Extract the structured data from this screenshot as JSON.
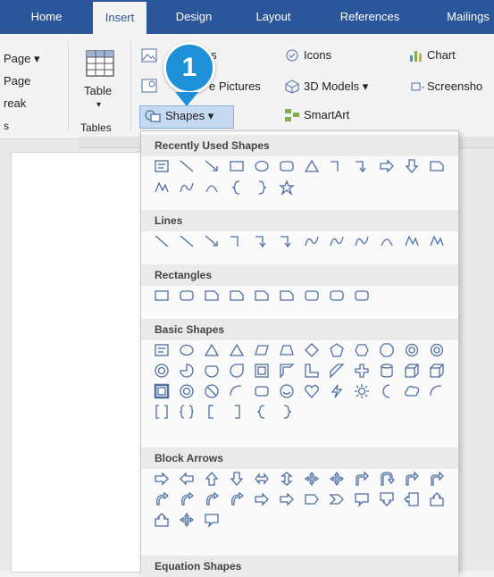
{
  "tabs": [
    {
      "label": "Home",
      "active": false
    },
    {
      "label": "Insert",
      "active": true
    },
    {
      "label": "Design",
      "active": false
    },
    {
      "label": "Layout",
      "active": false
    },
    {
      "label": "References",
      "active": false
    },
    {
      "label": "Mailings",
      "active": false
    }
  ],
  "ribbon": {
    "pages_group": {
      "items": [
        "Page",
        "Page",
        "reak"
      ],
      "group_label": "s"
    },
    "table": {
      "label": "Table",
      "group_label": "Tables"
    },
    "illustrations": {
      "pictures_partial": "s",
      "online_pictures": "e Pictures",
      "shapes": "Shapes",
      "icons": "Icons",
      "models_3d": "3D Models",
      "smartart": "SmartArt",
      "chart": "Chart",
      "screenshot": "Screensho"
    }
  },
  "callout": {
    "number": "1"
  },
  "shapes_gallery": {
    "sections": [
      {
        "title": "Recently Used Shapes",
        "rows": 2
      },
      {
        "title": "Lines",
        "rows": 1
      },
      {
        "title": "Rectangles",
        "rows": 1
      },
      {
        "title": "Basic Shapes",
        "rows": 4
      },
      {
        "title": "Block Arrows",
        "rows": 3
      },
      {
        "title": "Equation Shapes",
        "rows": 0
      }
    ]
  },
  "colors": {
    "tab_bar": "#2b579a",
    "ribbon": "#f3f3f3",
    "callout": "#1e90d7",
    "shape_stroke": "#4f6fa3",
    "gallery_header": "#eaeaea"
  }
}
